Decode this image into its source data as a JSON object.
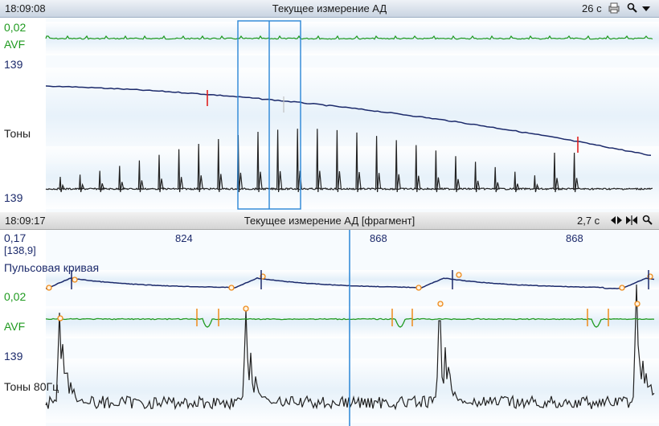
{
  "top_panel": {
    "time": "18:09:08",
    "title": "Текущее измерение АД",
    "duration": "26 с",
    "icons": [
      "printer-icon",
      "zoom-icon",
      "dropdown-arrow-icon"
    ],
    "labels": {
      "scale_avf": "0,02",
      "avf": "AVF",
      "pressure_top": "139",
      "tones": "Тоны",
      "pressure_bottom": "139"
    }
  },
  "bottom_panel": {
    "time": "18:09:17",
    "title": "Текущее измерение АД [фрагмент]",
    "duration": "2,7 с",
    "icons": [
      "scroll-left-right-icon",
      "fit-icon",
      "zoom-icon"
    ],
    "labels": {
      "scale_pulse": "0,17",
      "bracket_value": "[138,9]",
      "pulse_curve": "Пульсовая кривая",
      "scale_avf": "0,02",
      "avf": "AVF",
      "pressure": "139",
      "tones": "Тоны 80Гц"
    },
    "interval_labels": [
      "824",
      "868",
      "868"
    ]
  },
  "colors": {
    "ecg": "#1f9a1f",
    "pressure": "#1c2a6b",
    "tones": "#222222",
    "marker_red": "#e02020",
    "marker_orange": "#ee8a1a",
    "selection": "#2a86d6",
    "cursor": "#2a86d6"
  }
}
